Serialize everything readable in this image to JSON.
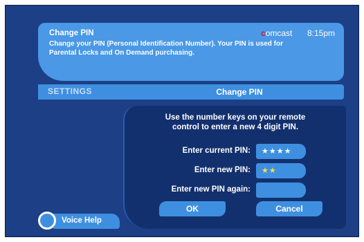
{
  "info": {
    "title": "Change PIN",
    "description": "Change your PIN (Personal Identification Number). Your PIN is used for Parental Locks and On Demand purchasing.",
    "brand_c": "c",
    "brand_rest": "omcast",
    "time": "8:15pm"
  },
  "bar": {
    "section": "SETTINGS",
    "title": "Change PIN"
  },
  "dialog": {
    "instruction_line1": "Use the number keys on your remote",
    "instruction_line2": "control to enter a new 4 digit PIN.",
    "fields": [
      {
        "label": "Enter current PIN:",
        "value": "★★★★"
      },
      {
        "label": "Enter new PIN:",
        "value": "★★"
      },
      {
        "label": "Enter new PIN again:",
        "value": ""
      }
    ],
    "ok_label": "OK",
    "cancel_label": "Cancel"
  },
  "voice_help": {
    "label": "Voice Help"
  },
  "colors": {
    "screen_bg": "#1c3f86",
    "panel_blue": "#4a98e6",
    "button_blue": "#3f8fe0",
    "dialog_bg": "#13306e",
    "active_star": "#f7e04a",
    "brand_red": "#c81e3c"
  }
}
